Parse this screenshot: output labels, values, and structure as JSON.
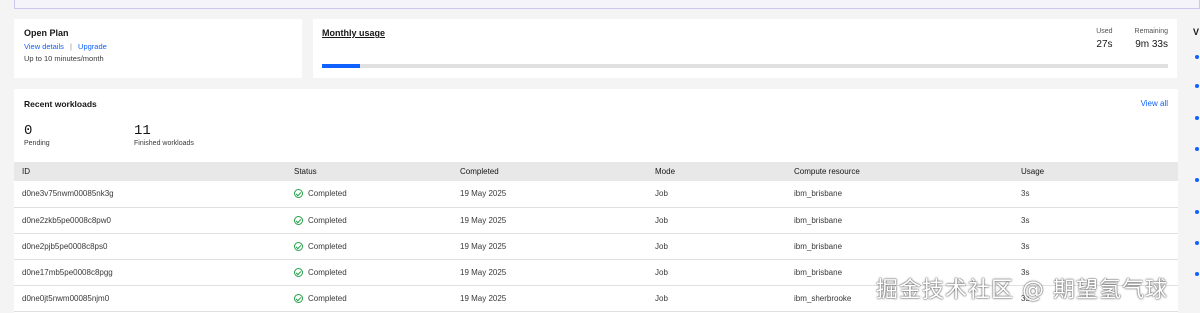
{
  "plan": {
    "title": "Open Plan",
    "view_details": "View details",
    "separator": "|",
    "upgrade": "Upgrade",
    "limit": "Up to 10 minutes/month"
  },
  "usage": {
    "title": "Monthly usage",
    "used_label": "Used",
    "used_value": "27s",
    "remaining_label": "Remaining",
    "remaining_value": "9m 33s",
    "progress_fraction": 0.045,
    "accent_color": "#0f62fe"
  },
  "workloads": {
    "title": "Recent workloads",
    "view_all": "View all",
    "pending_count": "0",
    "pending_label": "Pending",
    "finished_count": "11",
    "finished_label": "Finished workloads",
    "columns": [
      "ID",
      "Status",
      "Completed",
      "Mode",
      "Compute resource",
      "Usage"
    ],
    "rows": [
      {
        "id": "d0ne3v75nwm00085nk3g",
        "status": "Completed",
        "completed": "19 May 2025",
        "mode": "Job",
        "resource": "ibm_brisbane",
        "usage": "3s"
      },
      {
        "id": "d0ne2zkb5pe0008c8pw0",
        "status": "Completed",
        "completed": "19 May 2025",
        "mode": "Job",
        "resource": "ibm_brisbane",
        "usage": "3s"
      },
      {
        "id": "d0ne2pjb5pe0008c8ps0",
        "status": "Completed",
        "completed": "19 May 2025",
        "mode": "Job",
        "resource": "ibm_brisbane",
        "usage": "3s"
      },
      {
        "id": "d0ne17mb5pe0008c8pgg",
        "status": "Completed",
        "completed": "19 May 2025",
        "mode": "Job",
        "resource": "ibm_brisbane",
        "usage": "3s"
      },
      {
        "id": "d0ne0jt5nwm00085njm0",
        "status": "Completed",
        "completed": "19 May 2025",
        "mode": "Job",
        "resource": "ibm_sherbrooke",
        "usage": "3s"
      }
    ],
    "status_icon": "checkmark-circle-icon",
    "status_color": "#24a148"
  },
  "right_panel": {
    "heading_initial": "V"
  },
  "watermark": "掘金技术社区 @ 期望氢气球"
}
